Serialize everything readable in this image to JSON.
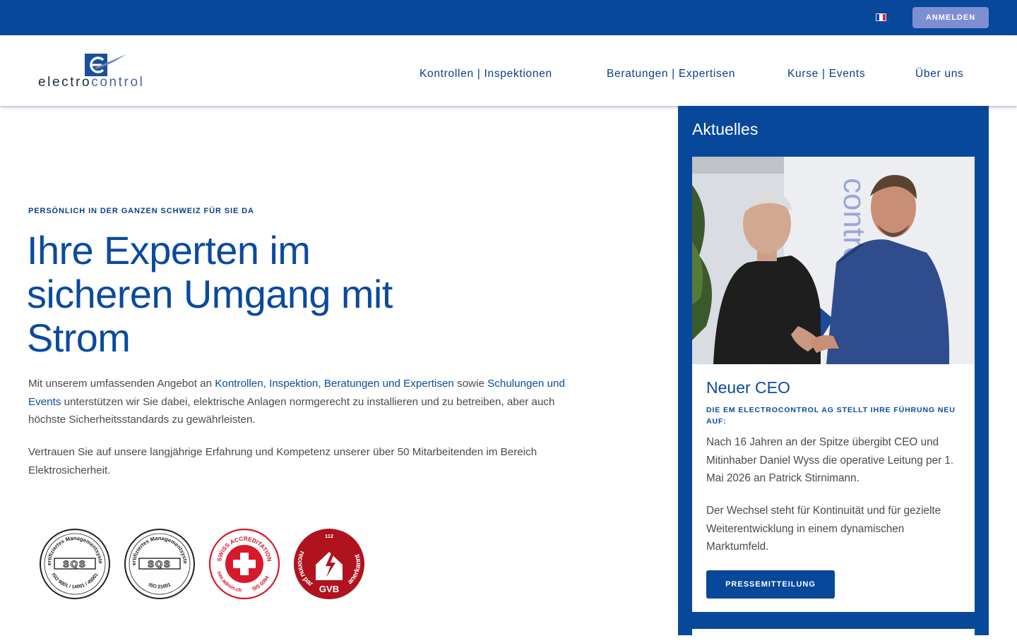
{
  "topbar": {
    "login_label": "ANMELDEN",
    "language_flag": "fr-flag-icon",
    "colors": {
      "bar": "#07489a",
      "button": "#7d8ed3"
    }
  },
  "header": {
    "logo": {
      "brand_dark": "electro",
      "brand_light": "control"
    },
    "nav": [
      {
        "label": "Kontrollen | Inspektionen"
      },
      {
        "label": "Beratungen | Expertisen"
      },
      {
        "label": "Kurse | Events"
      },
      {
        "label": "Über uns"
      }
    ]
  },
  "hero": {
    "eyebrow": "PERSÖNLICH IN DER GANZEN SCHWEIZ FÜR SIE DA",
    "title_lines": [
      "Ihre Experten im",
      "sicheren Umgang mit",
      "Strom"
    ],
    "p1": {
      "t1": "Mit unserem umfassenden Angebot an ",
      "link1": "Kontrollen",
      "t2": ", ",
      "link2": "Inspektion",
      "t3": ", ",
      "link3": "Beratungen und Expertisen",
      "t4": " sowie ",
      "link4": "Schulungen und Events",
      "t5": " unterstützen wir Sie dabei, elektrische Anlagen normgerecht zu installieren und zu betreiben, aber auch höchste Sicherheitsstandards zu gewährleisten."
    },
    "p2": "Vertrauen Sie auf unsere langjährige Erfahrung und Kompetenz unserer über 50 Mitarbeitenden im Bereich Elektrosicherheit."
  },
  "certifications": [
    {
      "icon": "sqs-certification-seal",
      "top_text": "Zertifiziertes Managementsystem",
      "center": "SQS",
      "bottom_text": "ISO 9001 / 14001 / 45001"
    },
    {
      "icon": "sqs-certification-seal",
      "top_text": "Zertifiziertes Managementsystem",
      "center": "SQS",
      "bottom_text": "ISO 21001"
    },
    {
      "icon": "swiss-accreditation-seal",
      "top_text": "SWISS ACCREDITATION",
      "left_text": "sas.admin.ch",
      "right_text": "SIS 0094"
    },
    {
      "icon": "gvb-seal",
      "number": "112",
      "left_text": "reconnu par",
      "right_text": "anerkannt",
      "center": "GVB"
    }
  ],
  "sidebar": {
    "title": "Aktuelles",
    "news": {
      "image": "two-men-handshake-photo",
      "title": "Neuer CEO",
      "subtitle": "DIE EM ELECTROCONTROL AG STELLT IHRE FÜHRUNG NEU AUF:",
      "p1": "Nach 16 Jahren an der Spitze übergibt CEO und Mitinhaber Daniel Wyss die operative Leitung per 1. Mai 2026 an Patrick Stirnimann.",
      "p2": "Der Wechsel steht für Kontinuität und für gezielte Weiterentwicklung in einem dynamischen Marktumfeld.",
      "button_label": "PRESSEMITTEILUNG"
    }
  }
}
